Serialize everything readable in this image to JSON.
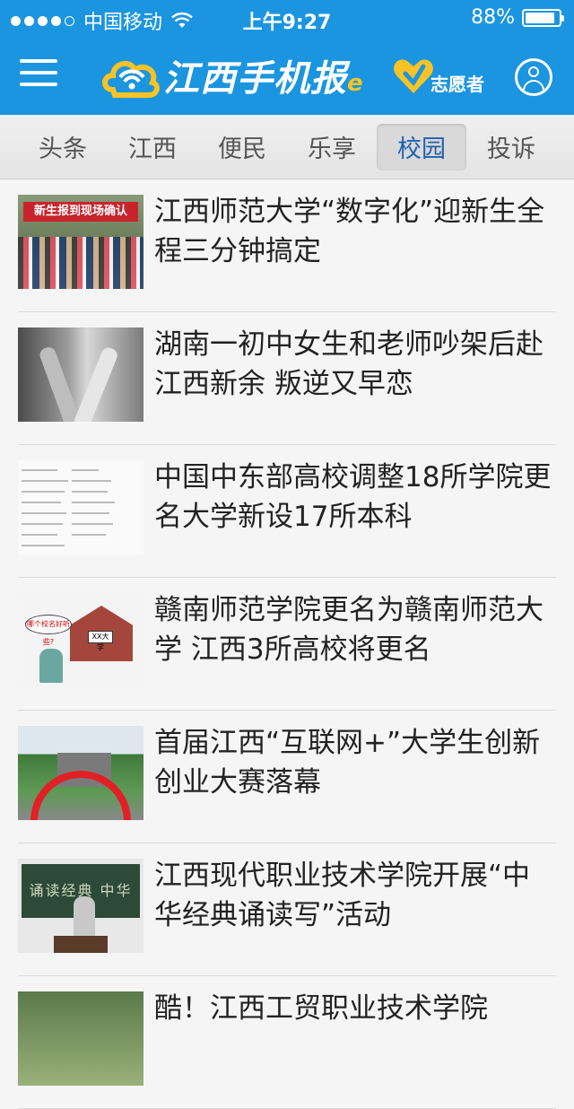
{
  "status_bar": {
    "carrier": "中国移动",
    "time": "上午9:27",
    "battery": "88%",
    "battery_level": 0.88
  },
  "header": {
    "app_name": "江西手机报",
    "logo_suffix": "e",
    "volunteer_label": "志愿者",
    "colors": {
      "bar": "#1c95e0",
      "accent": "#f7c325"
    }
  },
  "tabs": [
    {
      "label": "头条",
      "active": false
    },
    {
      "label": "江西",
      "active": false
    },
    {
      "label": "便民",
      "active": false
    },
    {
      "label": "乐享",
      "active": false
    },
    {
      "label": "校园",
      "active": true
    },
    {
      "label": "投诉",
      "active": false
    }
  ],
  "news": [
    {
      "title": "江西师范大学“数字化”迎新生全程三分钟搞定",
      "thumb_text": "新生报到现场确认"
    },
    {
      "title": "湖南一初中女生和老师吵架后赴江西新余 叛逆又早恋"
    },
    {
      "title": "中国中东部高校调整18所学院更名大学新设17所本科"
    },
    {
      "title": "赣南师范学院更名为赣南师范大学 江西3所高校将更名",
      "thumb_text": "哪个校名好听些?",
      "thumb_sign": "XX大学"
    },
    {
      "title": "首届江西“互联网+”大学生创新创业大赛落幕"
    },
    {
      "title": "江西现代职业技术学院开展“中华经典诵读写”活动",
      "thumb_text": "诵读经典 中华文化"
    },
    {
      "title": "酷！江西工贸职业技术学院"
    }
  ]
}
